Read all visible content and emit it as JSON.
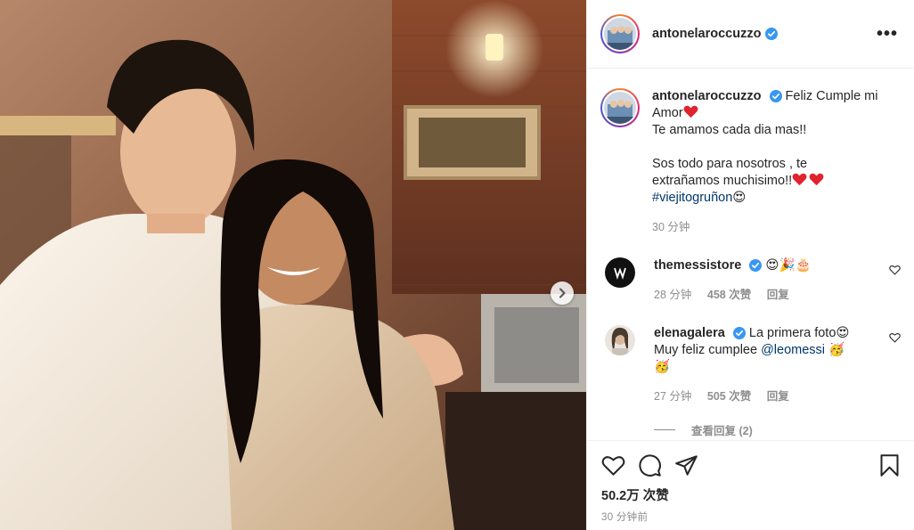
{
  "header": {
    "username": "antonelaroccuzzo",
    "more_label": "•••"
  },
  "caption": {
    "username": "antonelaroccuzzo",
    "line1": "Feliz Cumple mi",
    "line2": "Amor",
    "line3": "Te amamos cada dia mas!!",
    "line4": "Sos todo para nosotros , te",
    "line5": "extrañamos muchisimo!!",
    "hashtag": "#viejitogruñon",
    "time": "30 分钟"
  },
  "comments": [
    {
      "username": "themessistore",
      "text": "",
      "emojis": "😍🎉🎂",
      "time": "28 分钟",
      "likes": "458 次赞",
      "reply": "回复"
    },
    {
      "username": "elenagalera",
      "text": "La primera foto",
      "line2": "Muy feliz cumplee",
      "mention": "@leomessi",
      "emoji_end": "🥳",
      "time": "27 分钟",
      "likes": "505 次赞",
      "reply": "回复"
    }
  ],
  "view_replies": "查看回复 (2)",
  "footer": {
    "likes": "50.2万 次赞",
    "time": "30 分钟前"
  },
  "icons": {
    "like": "heart-icon",
    "comment": "comment-icon",
    "share": "share-icon",
    "save": "bookmark-icon",
    "next": "chevron-right-icon",
    "verified": "verified-badge-icon"
  },
  "colors": {
    "verified": "#3897f0",
    "heart_red": "#ed4956",
    "link": "#00376b",
    "muted": "#8e8e8e"
  }
}
